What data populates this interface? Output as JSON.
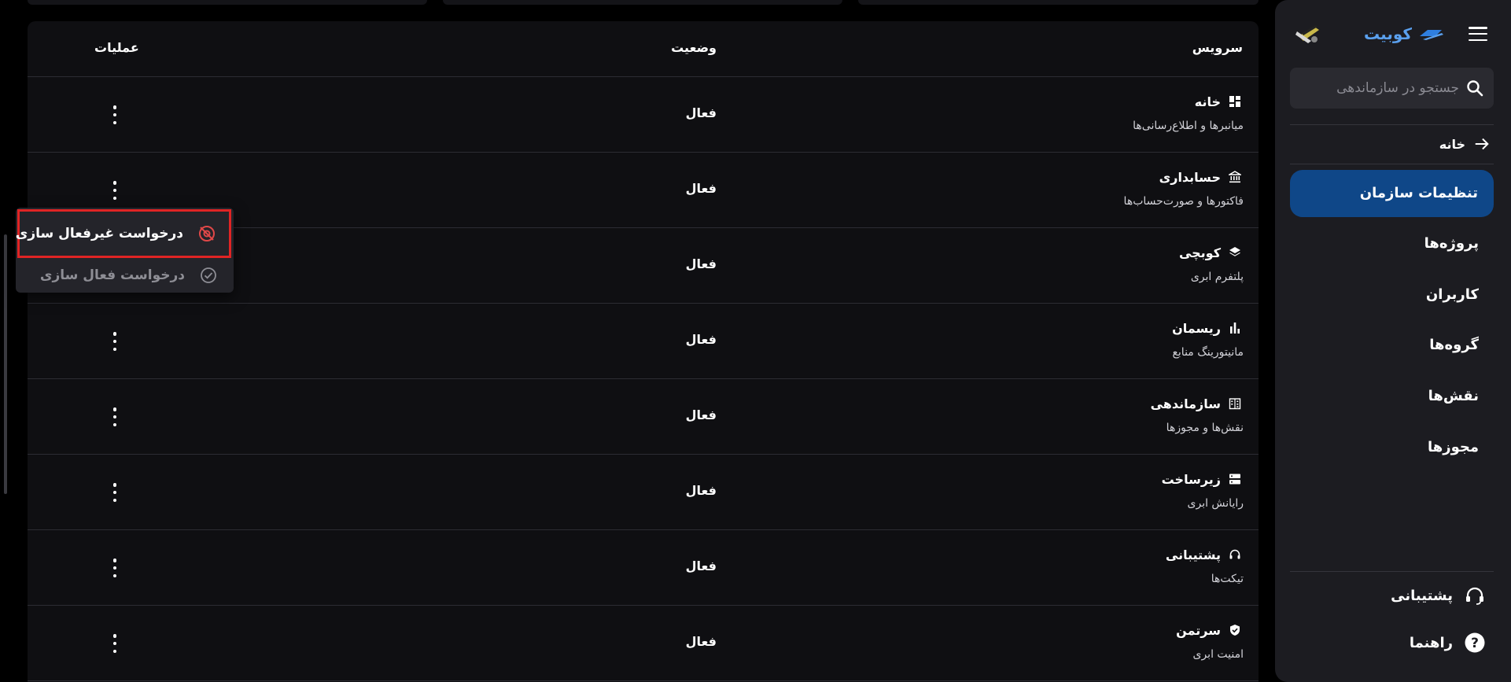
{
  "sidebar": {
    "brand_name": "کوبیت",
    "search_placeholder": "جستجو در سازماندهی",
    "home_label": "خانه",
    "active_label": "تنظیمات سازمان",
    "items": [
      {
        "label": "پروژه‌ها"
      },
      {
        "label": "کاربران"
      },
      {
        "label": "گروه‌ها"
      },
      {
        "label": "نقش‌ها"
      },
      {
        "label": "مجوزها"
      }
    ],
    "support_label": "پشتیبانی",
    "help_label": "راهنما",
    "accent_color": "#0f4788"
  },
  "table": {
    "headers": {
      "service": "سرویس",
      "status": "وضعیت",
      "actions": "عملیات"
    },
    "rows": [
      {
        "title": "خانه",
        "subtitle": "میانبرها و اطلاع‌رسانی‌ها",
        "status": "فعال",
        "icon": "dashboard-icon"
      },
      {
        "title": "حسابداری",
        "subtitle": "فاکتورها و صورت‌حساب‌ها",
        "status": "فعال",
        "icon": "bank-icon"
      },
      {
        "title": "کوبچی",
        "subtitle": "پلتفرم ابری",
        "status": "فعال",
        "icon": "layers-icon"
      },
      {
        "title": "ریسمان",
        "subtitle": "مانیتورینگ منابع",
        "status": "فعال",
        "icon": "bar-chart-icon"
      },
      {
        "title": "سازماندهی",
        "subtitle": "نقش‌ها و مجوزها",
        "status": "فعال",
        "icon": "building-icon"
      },
      {
        "title": "زیرساخت",
        "subtitle": "رایانش ابری",
        "status": "فعال",
        "icon": "server-icon"
      },
      {
        "title": "پشتیبانی",
        "subtitle": "تیکت‌ها",
        "status": "فعال",
        "icon": "headset-icon"
      },
      {
        "title": "سرتمن",
        "subtitle": "امنیت ابری",
        "status": "فعال",
        "icon": "shield-check-icon"
      }
    ]
  },
  "context_menu": {
    "deactivate_label": "درخواست غیرفعال سازی",
    "activate_label": "درخواست فعال سازی",
    "highlight_color": "#e02424"
  }
}
